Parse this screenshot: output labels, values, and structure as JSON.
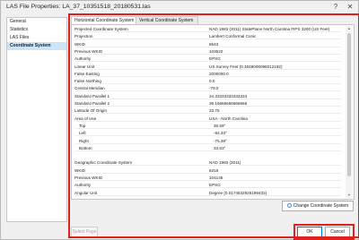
{
  "window": {
    "title": "LAS File Properties: LA_37_10351518_20180531.las",
    "help_icon": "?",
    "close_icon": "✕"
  },
  "sidebar": {
    "items": [
      {
        "label": "General"
      },
      {
        "label": "Statistics"
      },
      {
        "label": "LAS Files"
      },
      {
        "label": "Coordinate System"
      }
    ]
  },
  "tabs": [
    {
      "label": "Horizontal Coordinate System"
    },
    {
      "label": "Vertical Coordinate System"
    }
  ],
  "properties": [
    {
      "key": "Projected Coordinate System",
      "value": "NAD 1983 (2011) StatePlane North Carolina FIPS 3200 (US Feet)"
    },
    {
      "key": "Projection",
      "value": "Lambert Conformal Conic"
    },
    {
      "key": "WKID",
      "value": "6543"
    },
    {
      "key": "Previous WKID",
      "value": "103522"
    },
    {
      "key": "Authority",
      "value": "EPSG"
    },
    {
      "key": "Linear Unit",
      "value": "US Survey Feet (0.3048006096012192)"
    },
    {
      "key": "False Easting",
      "value": "2000000.0"
    },
    {
      "key": "False Northing",
      "value": "0.0"
    },
    {
      "key": "Central Meridian",
      "value": "-79.0"
    },
    {
      "key": "Standard Parallel 1",
      "value": "34.33333333333334"
    },
    {
      "key": "Standard Parallel 2",
      "value": "36.16666666666666"
    },
    {
      "key": "Latitude Of Origin",
      "value": "33.75"
    },
    {
      "key": "Area of Use",
      "value": "USA - North Carolina"
    },
    {
      "key": "Top",
      "value": "36.59°"
    },
    {
      "key": "Left",
      "value": "-84.33°"
    },
    {
      "key": "Right",
      "value": "-75.38°"
    },
    {
      "key": "Bottom",
      "value": "33.83°"
    },
    {
      "key": "",
      "value": ""
    },
    {
      "key": "Geographic Coordinate System",
      "value": "NAD 1983 (2011)"
    },
    {
      "key": "WKID",
      "value": "6318"
    },
    {
      "key": "Previous WKID",
      "value": "104145"
    },
    {
      "key": "Authority",
      "value": "EPSG"
    },
    {
      "key": "Angular Unit",
      "value": "Degree (0.0174532925199433)"
    }
  ],
  "buttons": {
    "change_cs": "Change Coordinate System",
    "select_page": "Select Page",
    "ok": "OK",
    "cancel": "Cancel"
  },
  "colors": {
    "selection": "#cce4f7",
    "highlight": "#e0201c"
  }
}
